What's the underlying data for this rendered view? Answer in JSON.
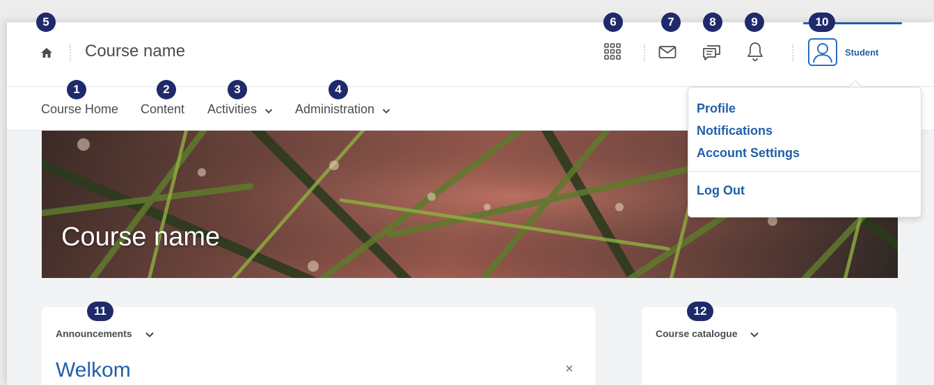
{
  "header": {
    "course_title": "Course name",
    "student_label": "Student"
  },
  "nav": {
    "items": [
      {
        "label": "Course Home"
      },
      {
        "label": "Content"
      },
      {
        "label": "Activities"
      },
      {
        "label": "Administration"
      }
    ]
  },
  "banner": {
    "title": "Course name"
  },
  "user_menu": {
    "items": [
      {
        "label": "Profile"
      },
      {
        "label": "Notifications"
      },
      {
        "label": "Account Settings"
      }
    ],
    "logout_label": "Log Out"
  },
  "widgets": {
    "announcements": {
      "title": "Announcements",
      "item_title": "Welkom",
      "dismiss": "×"
    },
    "catalogue": {
      "title": "Course catalogue"
    }
  },
  "badges": [
    "1",
    "2",
    "3",
    "4",
    "5",
    "6",
    "7",
    "8",
    "9",
    "10",
    "11",
    "12"
  ],
  "icons": {
    "home": "home-icon",
    "apps": "grid-icon",
    "mail": "mail-icon",
    "chat": "chat-icon",
    "bell": "bell-icon",
    "user": "user-icon",
    "chevron": "chevron-down-icon",
    "close": "close-icon"
  },
  "colors": {
    "link_blue": "#1f5fa8",
    "badge_navy": "#1f2a6b",
    "text_gray": "#494c4e",
    "page_bg": "#f1f3f5"
  }
}
